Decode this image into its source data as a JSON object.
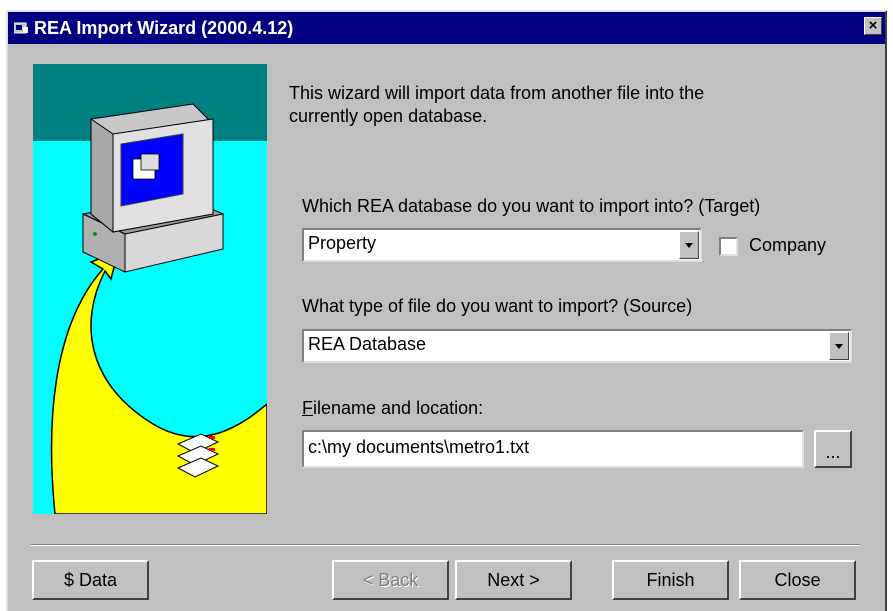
{
  "window": {
    "title": "REA Import Wizard (2000.4.12)",
    "close_symbol": "×"
  },
  "intro_text": "This wizard will import data from another file into the",
  "intro_text_2": "currently open database.",
  "target": {
    "label": "Which REA database do you want to import into? (Target)",
    "selected": "Property",
    "company_checkbox": {
      "label": "Company",
      "checked": false
    }
  },
  "source": {
    "label": "What type of file do you want to import? (Source)",
    "selected": "REA Database"
  },
  "file": {
    "label_mnemonic": "F",
    "label_rest": "ilename and location:",
    "value": "c:\\my documents\\metro1.txt",
    "browse_label": "..."
  },
  "buttons": {
    "data": "$ Data",
    "back": "< Back",
    "next": "Next >",
    "finish": "Finish",
    "close": "Close"
  },
  "colors": {
    "titlebar": "#000080",
    "dialog_face": "#c0c0c0",
    "illustration_sky": "#008080",
    "illustration_floor": "#00ffff",
    "path_yellow": "#ffff00"
  },
  "icons": [
    "app-icon",
    "computer-illustration",
    "arrow-path",
    "disks-icon",
    "dropdown-arrow-icon"
  ]
}
